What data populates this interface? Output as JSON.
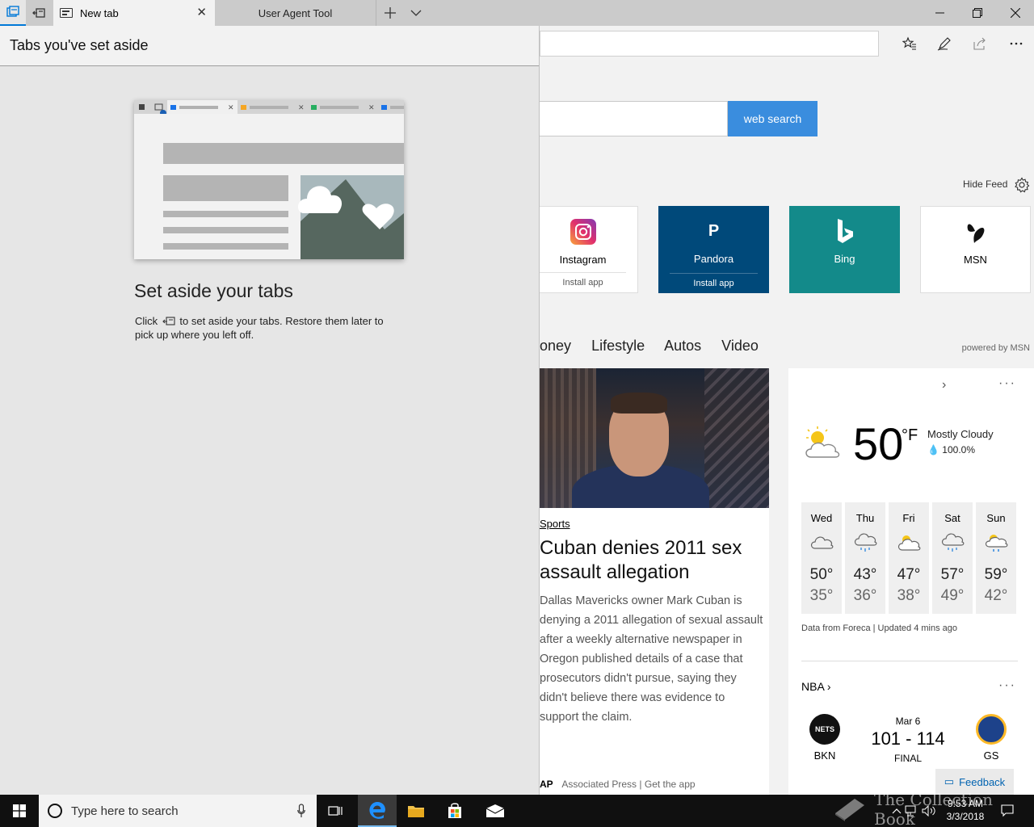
{
  "tabs": [
    {
      "label": "New tab",
      "active": true
    },
    {
      "label": "User Agent Tool",
      "active": false
    }
  ],
  "browser": {
    "search_button_label": "web search",
    "hide_feed_label": "Hide Feed",
    "tiles": [
      {
        "label": "Instagram",
        "install": "Install app",
        "bg": "#ffffff",
        "fg": "#000000"
      },
      {
        "label": "Pandora",
        "install": "Install app",
        "bg": "#00497a",
        "fg": "#ffffff"
      },
      {
        "label": "Bing",
        "install": "",
        "bg": "#138a8a",
        "fg": "#ffffff"
      },
      {
        "label": "MSN",
        "install": "",
        "bg": "#ffffff",
        "fg": "#000000"
      }
    ],
    "categories": [
      "oney",
      "Lifestyle",
      "Autos",
      "Video"
    ],
    "powered_by": "powered by MSN",
    "article": {
      "section": "Sports",
      "headline": "Cuban denies 2011 sex assault allegation",
      "body": "Dallas Mavericks owner Mark Cuban is denying a 2011 allegation of sexual assault after a weekly alternative newspaper in Oregon published details of a case that prosecutors didn't pursue, saying they didn't believe there was evidence to support the claim.",
      "source_logo": "AP",
      "source": "Associated Press",
      "source_link": "| Get the app"
    },
    "weather": {
      "temp": "50",
      "unit": "°F",
      "condition": "Mostly Cloudy",
      "precip": "100.0%",
      "forecast": [
        {
          "day": "Wed",
          "hi": "50°",
          "lo": "35°",
          "icon": "cloud"
        },
        {
          "day": "Thu",
          "hi": "43°",
          "lo": "36°",
          "icon": "rain"
        },
        {
          "day": "Fri",
          "hi": "47°",
          "lo": "38°",
          "icon": "partly-sunny"
        },
        {
          "day": "Sat",
          "hi": "57°",
          "lo": "49°",
          "icon": "rain"
        },
        {
          "day": "Sun",
          "hi": "59°",
          "lo": "42°",
          "icon": "sun-rain"
        }
      ],
      "source": "Data from Foreca | Updated 4 mins ago"
    },
    "nba": {
      "label": "NBA",
      "home": "BKN",
      "away": "GS",
      "home_logo": "NETS",
      "date": "Mar 6",
      "score": "101 - 114",
      "status": "FINAL"
    },
    "feedback_label": "Feedback"
  },
  "panel": {
    "header": "Tabs you've set aside",
    "title": "Set aside your tabs",
    "desc_before": "Click",
    "desc_after": "to set aside your tabs. Restore them later to pick up where you left off."
  },
  "taskbar": {
    "search_placeholder": "Type here to search",
    "time": "9:53 AM",
    "date": "3/3/2018"
  },
  "watermark": "The Collection Book",
  "colors": {
    "accent": "#0078d7",
    "search_button": "#3a8dde",
    "pandora": "#00497a",
    "bing": "#138a8a"
  }
}
